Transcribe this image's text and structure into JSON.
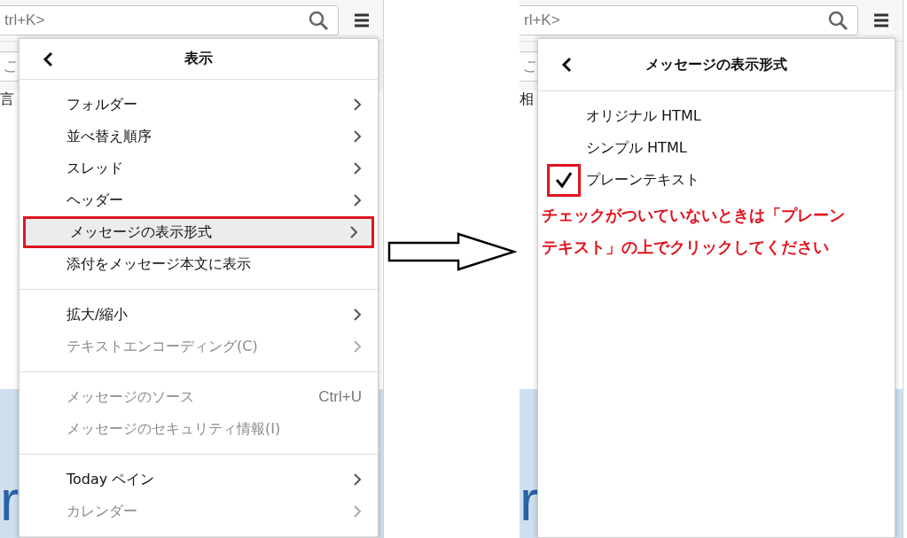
{
  "left_screen": {
    "background": {
      "search_text": "trl+K>",
      "field_text": "こ",
      "row_text": "言",
      "banner_text": "r"
    },
    "menu": {
      "title": "表示",
      "sections": [
        {
          "items": [
            {
              "label": "フォルダー",
              "submenu": true,
              "disabled": false,
              "selected": false,
              "marked": false
            },
            {
              "label": "並べ替え順序",
              "submenu": true,
              "disabled": false,
              "selected": false,
              "marked": false
            },
            {
              "label": "スレッド",
              "submenu": true,
              "disabled": false,
              "selected": false,
              "marked": false
            },
            {
              "label": "ヘッダー",
              "submenu": true,
              "disabled": false,
              "selected": false,
              "marked": false
            },
            {
              "label": "メッセージの表示形式",
              "submenu": true,
              "disabled": false,
              "selected": true,
              "marked": true
            },
            {
              "label": "添付をメッセージ本文に表示",
              "submenu": false,
              "disabled": false,
              "selected": false,
              "marked": false
            }
          ]
        },
        {
          "items": [
            {
              "label": "拡大/縮小",
              "submenu": true,
              "disabled": false,
              "selected": false,
              "marked": false
            },
            {
              "label": "テキストエンコーディング(C)",
              "submenu": true,
              "disabled": true,
              "selected": false,
              "marked": false
            }
          ]
        },
        {
          "items": [
            {
              "label": "メッセージのソース",
              "shortcut": "Ctrl+U",
              "submenu": false,
              "disabled": true,
              "selected": false,
              "marked": false
            },
            {
              "label": "メッセージのセキュリティ情報(I)",
              "submenu": false,
              "disabled": true,
              "selected": false,
              "marked": false
            }
          ]
        },
        {
          "items": [
            {
              "label": "Today ペイン",
              "submenu": true,
              "disabled": false,
              "selected": false,
              "marked": false
            },
            {
              "label": "カレンダー",
              "submenu": true,
              "disabled": true,
              "selected": false,
              "marked": false
            }
          ]
        }
      ]
    }
  },
  "right_screen": {
    "background": {
      "search_text": "rl+K>",
      "field_text": "こ",
      "row_text": "相",
      "banner_text": "r"
    },
    "menu": {
      "title": "メッセージの表示形式",
      "items": [
        {
          "label": "オリジナル HTML",
          "checked": false,
          "marked": false
        },
        {
          "label": "シンプル HTML",
          "checked": false,
          "marked": false
        },
        {
          "label": "プレーンテキスト",
          "checked": true,
          "marked": true
        }
      ],
      "note": "チェックがついていないときは「プレーンテキスト」の上でクリックしてください"
    }
  }
}
